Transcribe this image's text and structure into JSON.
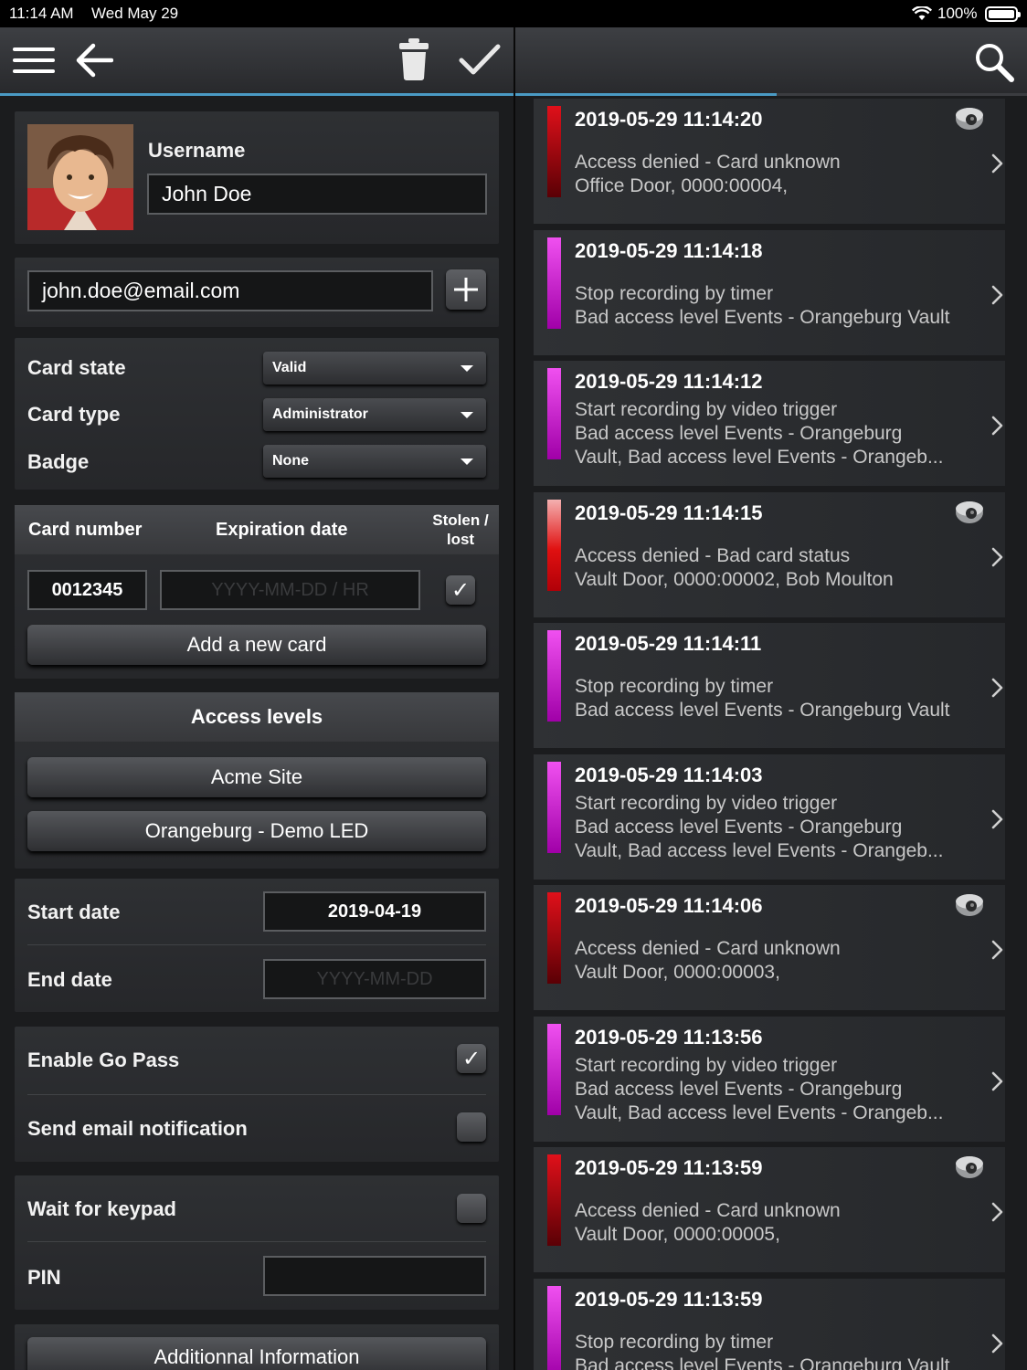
{
  "status_bar": {
    "time": "11:14 AM",
    "date": "Wed May 29",
    "battery": "100%"
  },
  "toolbar": {
    "menu_icon": "hamburger-icon",
    "back_icon": "arrow-left-icon",
    "delete_icon": "trash-icon",
    "confirm_icon": "checkmark-icon",
    "search_icon": "search-icon"
  },
  "user": {
    "username_label": "Username",
    "username_value": "John Doe",
    "email_value": "john.doe@email.com"
  },
  "card_settings": {
    "card_state_label": "Card state",
    "card_state_value": "Valid",
    "card_type_label": "Card type",
    "card_type_value": "Administrator",
    "badge_label": "Badge",
    "badge_value": "None"
  },
  "cards": {
    "col_card_number": "Card number",
    "col_expiration": "Expiration date",
    "col_stolen": "Stolen / lost",
    "card_number_value": "0012345",
    "expiration_placeholder": "YYYY-MM-DD / HR",
    "stolen_checked": true,
    "add_card_label": "Add a new card"
  },
  "access_levels": {
    "header": "Access levels",
    "items": [
      "Acme Site",
      "Orangeburg - Demo LED"
    ]
  },
  "dates": {
    "start_label": "Start date",
    "start_value": "2019-04-19",
    "end_label": "End date",
    "end_placeholder": "YYYY-MM-DD"
  },
  "options": {
    "go_pass_label": "Enable Go Pass",
    "go_pass_checked": true,
    "email_notify_label": "Send email notification",
    "email_notify_checked": false,
    "wait_keypad_label": "Wait for keypad",
    "wait_keypad_checked": false,
    "pin_label": "PIN",
    "additional_info_label": "Additionnal Information"
  },
  "events": [
    {
      "timestamp": "2019-05-29 11:14:20",
      "lines": [
        "Access denied - Card unknown",
        "Office Door, 0000:00004,"
      ],
      "color": "red",
      "camera": true
    },
    {
      "timestamp": "2019-05-29 11:14:18",
      "lines": [
        "Stop recording by timer",
        "Bad access level Events - Orangeburg Vault"
      ],
      "color": "magenta",
      "camera": false
    },
    {
      "timestamp": "2019-05-29 11:14:12",
      "lines": [
        "Start recording by video trigger",
        "Bad access level Events - Orangeburg",
        "Vault, Bad access level Events - Orangeb..."
      ],
      "color": "magenta",
      "camera": false
    },
    {
      "timestamp": "2019-05-29 11:14:15",
      "lines": [
        "Access denied - Bad card status",
        "Vault Door, 0000:00002,  Bob Moulton"
      ],
      "color": "pink-red",
      "camera": true
    },
    {
      "timestamp": "2019-05-29 11:14:11",
      "lines": [
        "Stop recording by timer",
        "Bad access level Events - Orangeburg Vault"
      ],
      "color": "magenta",
      "camera": false
    },
    {
      "timestamp": "2019-05-29 11:14:03",
      "lines": [
        "Start recording by video trigger",
        "Bad access level Events - Orangeburg",
        "Vault, Bad access level Events - Orangeb..."
      ],
      "color": "magenta",
      "camera": false
    },
    {
      "timestamp": "2019-05-29 11:14:06",
      "lines": [
        "Access denied - Card unknown",
        "Vault Door, 0000:00003,"
      ],
      "color": "red",
      "camera": true
    },
    {
      "timestamp": "2019-05-29 11:13:56",
      "lines": [
        "Start recording by video trigger",
        "Bad access level Events - Orangeburg",
        "Vault, Bad access level Events - Orangeb..."
      ],
      "color": "magenta",
      "camera": false
    },
    {
      "timestamp": "2019-05-29 11:13:59",
      "lines": [
        "Access denied - Card unknown",
        "Vault Door, 0000:00005,"
      ],
      "color": "red",
      "camera": true
    },
    {
      "timestamp": "2019-05-29 11:13:59",
      "lines": [
        "Stop recording by timer",
        "Bad access level Events - Orangeburg Vault"
      ],
      "color": "magenta",
      "camera": false
    }
  ],
  "colors": {
    "accent": "#4a9ac4",
    "red": "#e0101a",
    "magenta": "#e010e0",
    "pink-red": "#f0a0a0"
  },
  "list_progress": 0.51
}
